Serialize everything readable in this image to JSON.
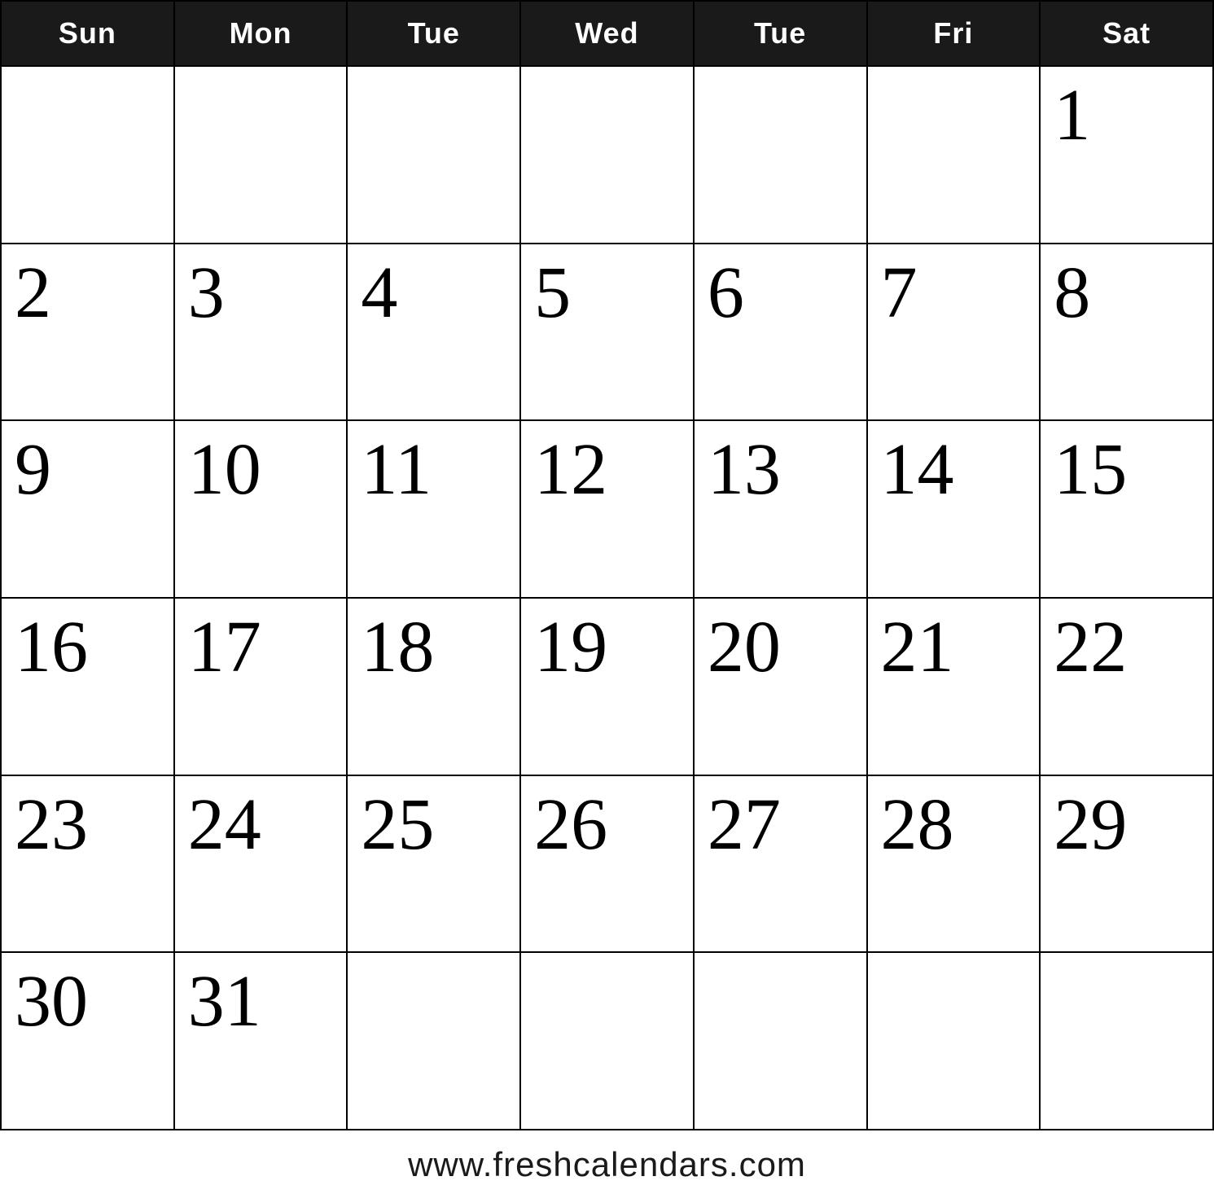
{
  "header": {
    "days": [
      "Sun",
      "Mon",
      "Tue",
      "Wed",
      "Tue",
      "Fri",
      "Sat"
    ]
  },
  "weeks": [
    [
      "",
      "",
      "",
      "",
      "",
      "",
      "1"
    ],
    [
      "2",
      "3",
      "4",
      "5",
      "6",
      "7",
      "8"
    ],
    [
      "9",
      "10",
      "11",
      "12",
      "13",
      "14",
      "15"
    ],
    [
      "16",
      "17",
      "18",
      "19",
      "20",
      "21",
      "22"
    ],
    [
      "23",
      "24",
      "25",
      "26",
      "27",
      "28",
      "29"
    ],
    [
      "30",
      "31",
      "",
      "",
      "",
      "",
      ""
    ]
  ],
  "footer": {
    "url": "www.freshcalendars.com"
  }
}
